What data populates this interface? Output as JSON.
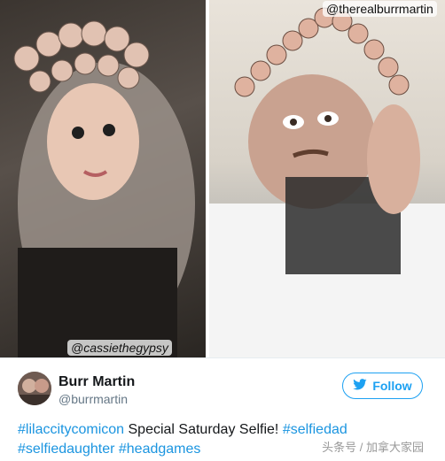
{
  "photos": {
    "left_watermark": "@cassiethegypsy",
    "right_watermark": "@therealburrmartin"
  },
  "tweet": {
    "name": "Burr Martin",
    "handle": "@burrmartin",
    "follow_label": "Follow",
    "text_line1": [
      {
        "type": "tag",
        "text": "#lilaccitycomicon"
      },
      {
        "type": "plain",
        "text": " Special Saturday Selfie! "
      },
      {
        "type": "tag",
        "text": "#selfiedad"
      }
    ],
    "text_line2": [
      {
        "type": "tag",
        "text": "#selfiedaughter"
      },
      {
        "type": "plain",
        "text": " "
      },
      {
        "type": "tag",
        "text": "#headgames"
      }
    ],
    "icons": {
      "follow": "twitter-bird-icon"
    },
    "colors": {
      "accent": "#1da1f2",
      "hashtag": "#1b95e0"
    }
  },
  "source_watermark": "头条号 / 加拿大家园"
}
